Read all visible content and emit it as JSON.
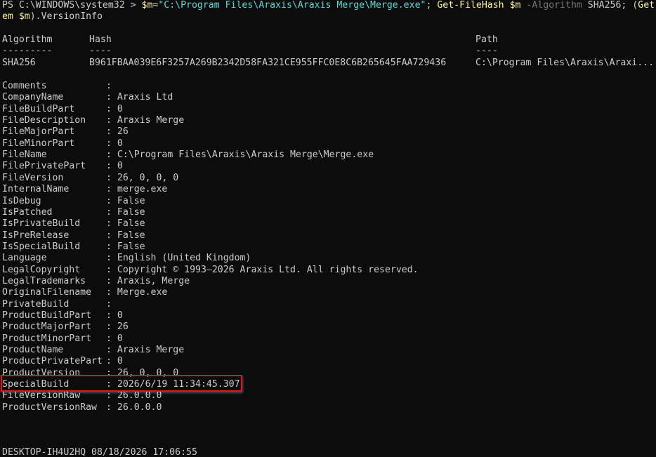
{
  "command": {
    "prompt": "PS C:\\WINDOWS\\system32 > ",
    "var1": "$m",
    "eq": "=",
    "path_string": "\"C:\\Program Files\\Araxis\\Araxis Merge\\Merge.exe\"",
    "sep": "; ",
    "cmdlet1": "Get-FileHash",
    "space": " ",
    "var2": "$m",
    "param": "-Algorithm",
    "algo_arg": "SHA256",
    "open": "; (",
    "cmdlet2_part1": "Get-It",
    "cmdlet2_part2": "em",
    "var3": "$m",
    "tail": ").VersionInfo"
  },
  "hash_table": {
    "headers": [
      "Algorithm",
      "Hash",
      "Path"
    ],
    "underlines": [
      "---------",
      "----",
      "----"
    ],
    "row": [
      "SHA256",
      "B961FBAA039E6F3257A269B2342D58FA321CE955FFC0E8C6B265645FAA729436",
      "C:\\Program Files\\Araxis\\Araxi..."
    ]
  },
  "version_info": [
    {
      "key": "Comments",
      "value": ""
    },
    {
      "key": "CompanyName",
      "value": "Araxis Ltd"
    },
    {
      "key": "FileBuildPart",
      "value": "0"
    },
    {
      "key": "FileDescription",
      "value": "Araxis Merge"
    },
    {
      "key": "FileMajorPart",
      "value": "26"
    },
    {
      "key": "FileMinorPart",
      "value": "0"
    },
    {
      "key": "FileName",
      "value": "C:\\Program Files\\Araxis\\Araxis Merge\\Merge.exe"
    },
    {
      "key": "FilePrivatePart",
      "value": "0"
    },
    {
      "key": "FileVersion",
      "value": "26, 0, 0, 0"
    },
    {
      "key": "InternalName",
      "value": "merge.exe"
    },
    {
      "key": "IsDebug",
      "value": "False"
    },
    {
      "key": "IsPatched",
      "value": "False"
    },
    {
      "key": "IsPrivateBuild",
      "value": "False"
    },
    {
      "key": "IsPreRelease",
      "value": "False"
    },
    {
      "key": "IsSpecialBuild",
      "value": "False"
    },
    {
      "key": "Language",
      "value": "English (United Kingdom)"
    },
    {
      "key": "LegalCopyright",
      "value": "Copyright © 1993–2026 Araxis Ltd. All rights reserved."
    },
    {
      "key": "LegalTrademarks",
      "value": "Araxis, Merge"
    },
    {
      "key": "OriginalFilename",
      "value": "Merge.exe"
    },
    {
      "key": "PrivateBuild",
      "value": ""
    },
    {
      "key": "ProductBuildPart",
      "value": "0"
    },
    {
      "key": "ProductMajorPart",
      "value": "26"
    },
    {
      "key": "ProductMinorPart",
      "value": "0"
    },
    {
      "key": "ProductName",
      "value": "Araxis Merge"
    },
    {
      "key": "ProductPrivatePart",
      "value": "0"
    },
    {
      "key": "ProductVersion",
      "value": "26, 0, 0, 0"
    },
    {
      "key": "SpecialBuild",
      "value": "2026/6/19 11:34:45.307"
    },
    {
      "key": "FileVersionRaw",
      "value": "26.0.0.0"
    },
    {
      "key": "ProductVersionRaw",
      "value": "26.0.0.0"
    }
  ],
  "separator": ": ",
  "status_line": "DESKTOP-IH4U2HQ 08/18/2026 17:06:55",
  "colors": {
    "background": "#0c0c0c",
    "text": "#cccccc",
    "command_yellow": "#f9f1a5",
    "string_cyan": "#61d6d6",
    "param_gray": "#767676",
    "highlight_red": "#e81123"
  }
}
